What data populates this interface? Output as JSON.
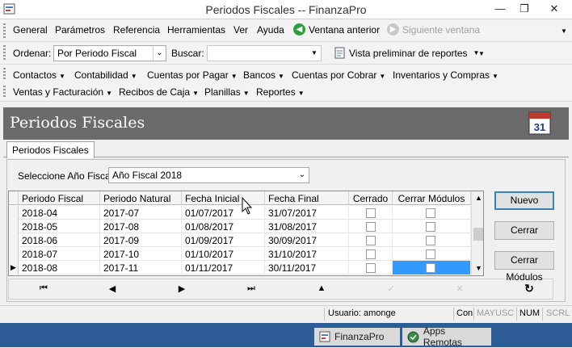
{
  "window": {
    "title": "Periodos Fiscales -- FinanzaPro",
    "minimize": "—",
    "maximize": "❐",
    "close": "✕"
  },
  "menubar": {
    "items": [
      "General",
      "Parámetros",
      "Referencia",
      "Herramientas",
      "Ver",
      "Ayuda"
    ],
    "back": "Ventana anterior",
    "forward": "Siguiente ventana"
  },
  "toolbar": {
    "order_label": "Ordenar:",
    "order_value": "Por Periodo Fiscal",
    "search_label": "Buscar:",
    "search_value": "",
    "preview": "Vista preliminar de reportes"
  },
  "modules": {
    "row1": [
      "Contactos",
      "Contabilidad",
      "Cuentas por Pagar",
      "Bancos",
      "Cuentas por Cobrar",
      "Inventarios y Compras"
    ],
    "row2": [
      "Ventas y Facturación",
      "Recibos de Caja",
      "Planillas",
      "Reportes"
    ]
  },
  "header": {
    "title": "Periodos Fiscales",
    "calendar_day": "31"
  },
  "tab": {
    "label": "Periodos Fiscales"
  },
  "filter": {
    "label": "Seleccione Año Fiscal:",
    "value": "Año Fiscal 2018"
  },
  "grid": {
    "columns": [
      "Periodo Fiscal",
      "Periodo Natural",
      "Fecha Inicial",
      "Fecha Final",
      "Cerrado",
      "Cerrar Módulos"
    ],
    "rows": [
      {
        "periodo_fiscal": "2018-04",
        "periodo_natural": "2017-07",
        "fecha_inicial": "01/07/2017",
        "fecha_final": "31/07/2017",
        "cerrado": false,
        "cerrar_modulos": false
      },
      {
        "periodo_fiscal": "2018-05",
        "periodo_natural": "2017-08",
        "fecha_inicial": "01/08/2017",
        "fecha_final": "31/08/2017",
        "cerrado": false,
        "cerrar_modulos": false
      },
      {
        "periodo_fiscal": "2018-06",
        "periodo_natural": "2017-09",
        "fecha_inicial": "01/09/2017",
        "fecha_final": "30/09/2017",
        "cerrado": false,
        "cerrar_modulos": false
      },
      {
        "periodo_fiscal": "2018-07",
        "periodo_natural": "2017-10",
        "fecha_inicial": "01/10/2017",
        "fecha_final": "31/10/2017",
        "cerrado": false,
        "cerrar_modulos": false
      },
      {
        "periodo_fiscal": "2018-08",
        "periodo_natural": "2017-11",
        "fecha_inicial": "01/11/2017",
        "fecha_final": "30/11/2017",
        "cerrado": false,
        "cerrar_modulos": false
      }
    ],
    "current_row_marker": "▶"
  },
  "buttons": {
    "nuevo": "Nuevo",
    "cerrar": "Cerrar",
    "cerrar_modulos": "Cerrar Módulos"
  },
  "status": {
    "usuario": "Usuario: amonge",
    "con": "Con",
    "mayusc": "MAYUSC",
    "num": "NUM",
    "scrl": "SCRL"
  },
  "taskbar": {
    "app": "FinanzaPro",
    "remote": "Apps Remotas"
  },
  "colors": {
    "header_band": "#6b6b6b",
    "selection": "#3399ff",
    "taskbar": "#2e5c96",
    "back_icon": "#2e9e3e"
  }
}
